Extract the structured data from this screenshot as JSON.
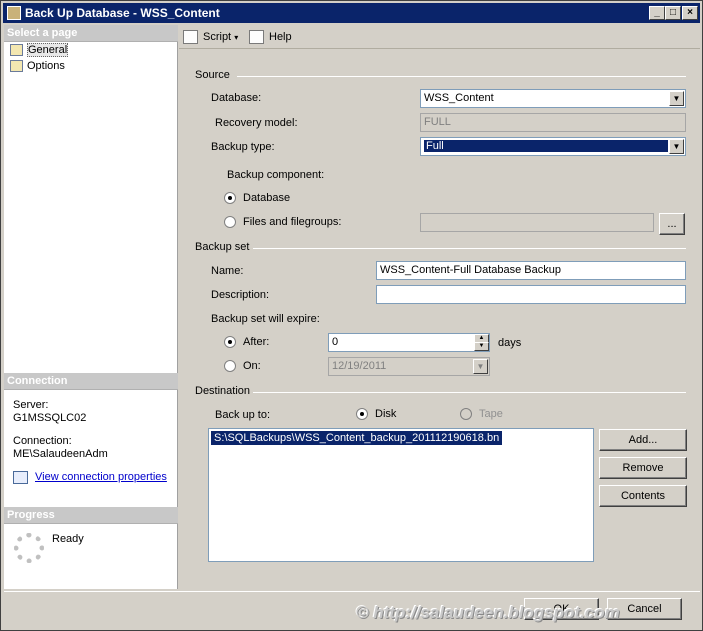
{
  "window": {
    "title": "Back Up Database - WSS_Content"
  },
  "left": {
    "select_page_header": "Select a page",
    "pages": [
      {
        "label": "General"
      },
      {
        "label": "Options"
      }
    ],
    "connection_header": "Connection",
    "server_label": "Server:",
    "server_value": "G1MSSQLC02",
    "connection_label": "Connection:",
    "connection_value": "ME\\SalaudeenAdm",
    "view_props_link": "View connection properties",
    "progress_header": "Progress",
    "progress_status": "Ready"
  },
  "toolbar": {
    "script_label": "Script",
    "help_label": "Help"
  },
  "source": {
    "group_label": "Source",
    "database_label": "Database:",
    "database_value": "WSS_Content",
    "recovery_label": "Recovery model:",
    "recovery_value": "FULL",
    "backup_type_label": "Backup type:",
    "backup_type_value": "Full",
    "component_label": "Backup component:",
    "component_database": "Database",
    "component_files": "Files and filegroups:",
    "browse_label": "..."
  },
  "backup_set": {
    "group_label": "Backup set",
    "name_label": "Name:",
    "name_value": "WSS_Content-Full Database Backup",
    "description_label": "Description:",
    "description_value": "",
    "expire_label": "Backup set will expire:",
    "after_label": "After:",
    "after_value": "0",
    "days_label": "days",
    "on_label": "On:",
    "on_value": "12/19/2011"
  },
  "destination": {
    "group_label": "Destination",
    "backup_to_label": "Back up to:",
    "disk_label": "Disk",
    "tape_label": "Tape",
    "items": [
      "S:\\SQLBackups\\WSS_Content_backup_201112190618.bn"
    ],
    "add_label": "Add...",
    "remove_label": "Remove",
    "contents_label": "Contents"
  },
  "footer": {
    "ok_label": "OK",
    "cancel_label": "Cancel",
    "watermark": "© http://salaudeen.blogspot.com"
  }
}
